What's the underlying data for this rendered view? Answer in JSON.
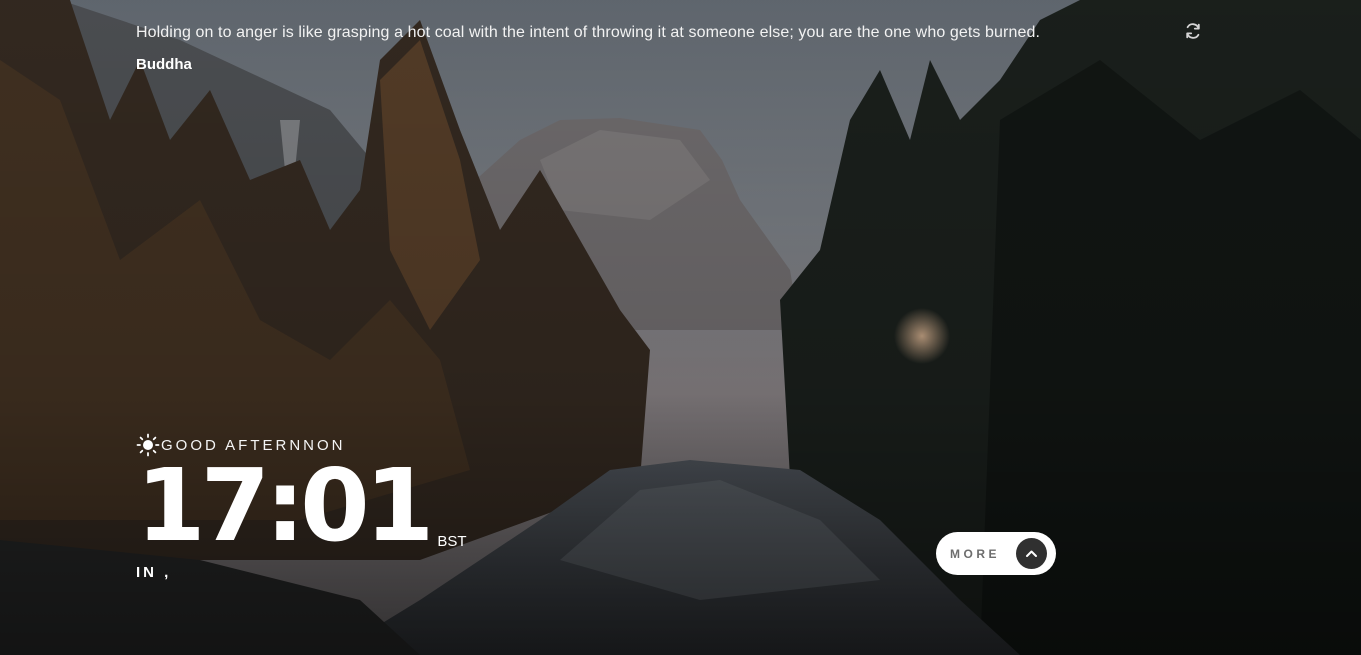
{
  "quote": {
    "text": "Holding on to anger is like grasping a hot coal with the intent of throwing it at someone else; you are the one who gets burned.",
    "author": "Buddha",
    "refresh_icon": "refresh-icon"
  },
  "clock": {
    "greeting": "GOOD AFTERNNON",
    "greeting_icon": "sun-icon",
    "time": "17:01",
    "timezone": "BST",
    "location": "IN ,"
  },
  "more_button": {
    "label": "MORE",
    "icon": "chevron-up-icon"
  },
  "colors": {
    "text": "#ffffff",
    "button_bg": "#ffffff",
    "button_text": "#6d6d6d",
    "arrow_bg": "#303030"
  }
}
